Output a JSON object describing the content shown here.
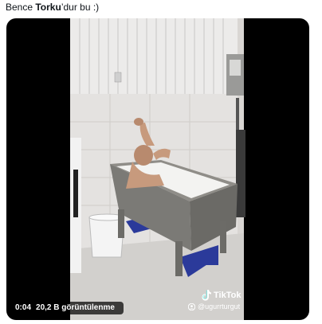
{
  "tweet": {
    "text_before": "Bence ",
    "text_bold": "Torku",
    "text_after": "’dur bu :)"
  },
  "video": {
    "elapsed": "0:04",
    "views": "20,2 B görüntülenme",
    "watermark_brand": "TikTok",
    "watermark_handle": "@ugurrturgut"
  },
  "icons": {
    "brand": "tiktok-icon",
    "user": "user-icon"
  }
}
